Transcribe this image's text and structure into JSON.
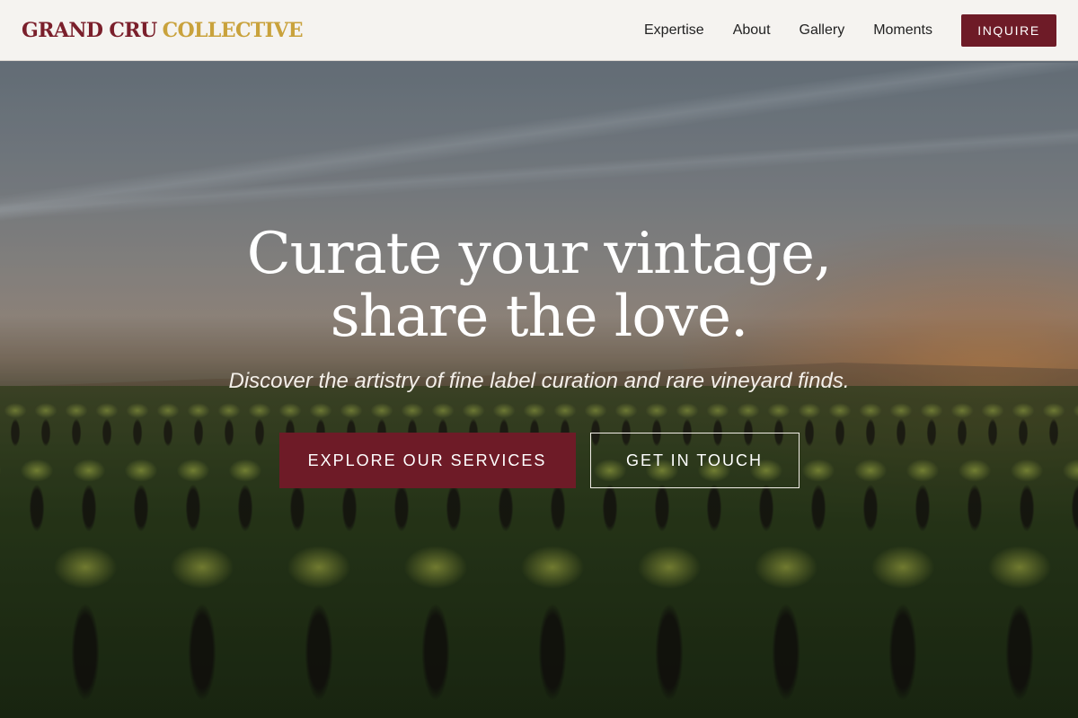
{
  "header": {
    "brand_primary": "GRAND CRU",
    "brand_secondary": "COLLECTIVE",
    "nav": [
      {
        "label": "Expertise"
      },
      {
        "label": "About"
      },
      {
        "label": "Gallery"
      },
      {
        "label": "Moments"
      }
    ],
    "cta_label": "INQUIRE"
  },
  "hero": {
    "title_line1": "Curate your vintage,",
    "title_line2": "share the love.",
    "subtitle": "Discover the artistry of fine label curation and rare vineyard finds.",
    "primary_button": "EXPLORE OUR SERVICES",
    "secondary_button": "GET IN TOUCH",
    "background_image": "vineyard-sunset"
  },
  "colors": {
    "brand_burgundy": "#6e1b27",
    "brand_gold": "#c9a23c",
    "header_bg": "#f5f3f0"
  }
}
